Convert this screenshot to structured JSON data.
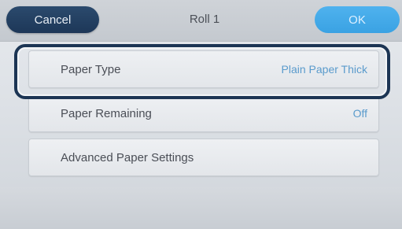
{
  "header": {
    "cancel_label": "Cancel",
    "title": "Roll 1",
    "ok_label": "OK"
  },
  "settings": [
    {
      "label": "Paper Type",
      "value": "Plain Paper Thick",
      "selected": true
    },
    {
      "label": "Paper Remaining",
      "value": "Off",
      "selected": false
    },
    {
      "label": "Advanced Paper Settings",
      "value": "",
      "selected": false
    }
  ],
  "colors": {
    "cancel_button": "#1d3758",
    "ok_button": "#3aa2e3",
    "value_text": "#5a9bcc",
    "selection_outline": "#1c3554"
  }
}
